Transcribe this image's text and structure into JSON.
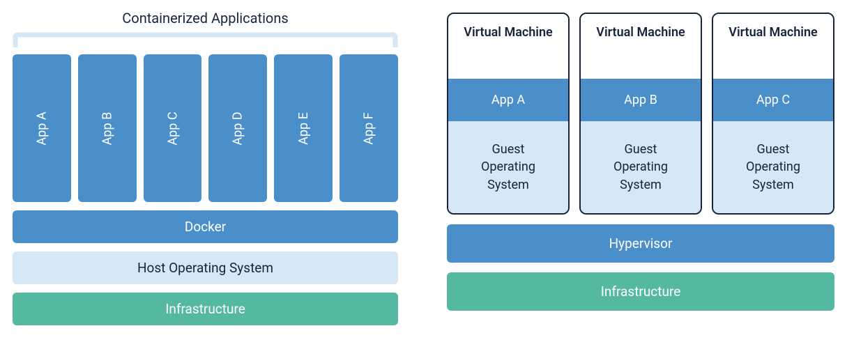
{
  "left": {
    "title": "Containerized Applications",
    "apps": [
      "App A",
      "App B",
      "App C",
      "App D",
      "App E",
      "App F"
    ],
    "layers": {
      "docker": "Docker",
      "host_os": "Host Operating System",
      "infra": "Infrastructure"
    }
  },
  "right": {
    "vms": [
      {
        "header": "Virtual Machine",
        "app": "App A",
        "guest": "Guest\nOperating\nSystem"
      },
      {
        "header": "Virtual Machine",
        "app": "App B",
        "guest": "Guest\nOperating\nSystem"
      },
      {
        "header": "Virtual Machine",
        "app": "App C",
        "guest": "Guest\nOperating\nSystem"
      }
    ],
    "layers": {
      "hypervisor": "Hypervisor",
      "infra": "Infrastructure"
    }
  },
  "colors": {
    "blue": "#4a8fca",
    "lightblue": "#d6e8f6",
    "green": "#55b8a1",
    "dark": "#17243c"
  }
}
